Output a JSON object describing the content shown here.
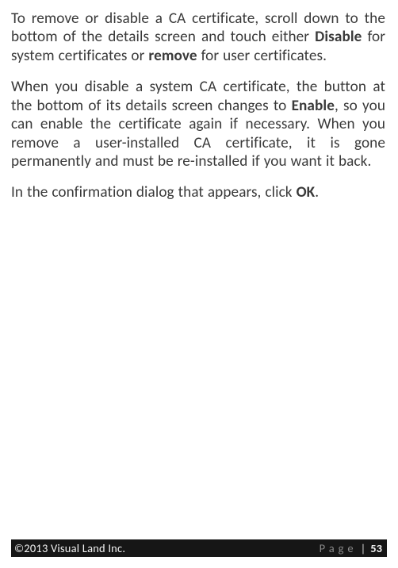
{
  "paragraphs": {
    "p1": {
      "s1": "To remove or disable a CA certificate, scroll down to the bottom of the details screen and touch either ",
      "b1": "Disable",
      "s2": " for system certificates or ",
      "b2": "remove",
      "s3": " for user certificates."
    },
    "p2": {
      "s1": "When you disable a system CA certificate, the button at the bottom of its details screen changes to ",
      "b1": "Enable",
      "s2": ", so you can enable the certificate again if necessary. When you remove a user-installed CA certificate, it is gone permanently and must be re-installed if you want it back."
    },
    "p3": {
      "s1": "In the confirmation dialog that appears, click ",
      "b1": "OK",
      "s2": "."
    }
  },
  "footer": {
    "copyright": "©2013 Visual Land Inc.",
    "page_word": "Page",
    "pipe": "|",
    "page_num": "53"
  }
}
